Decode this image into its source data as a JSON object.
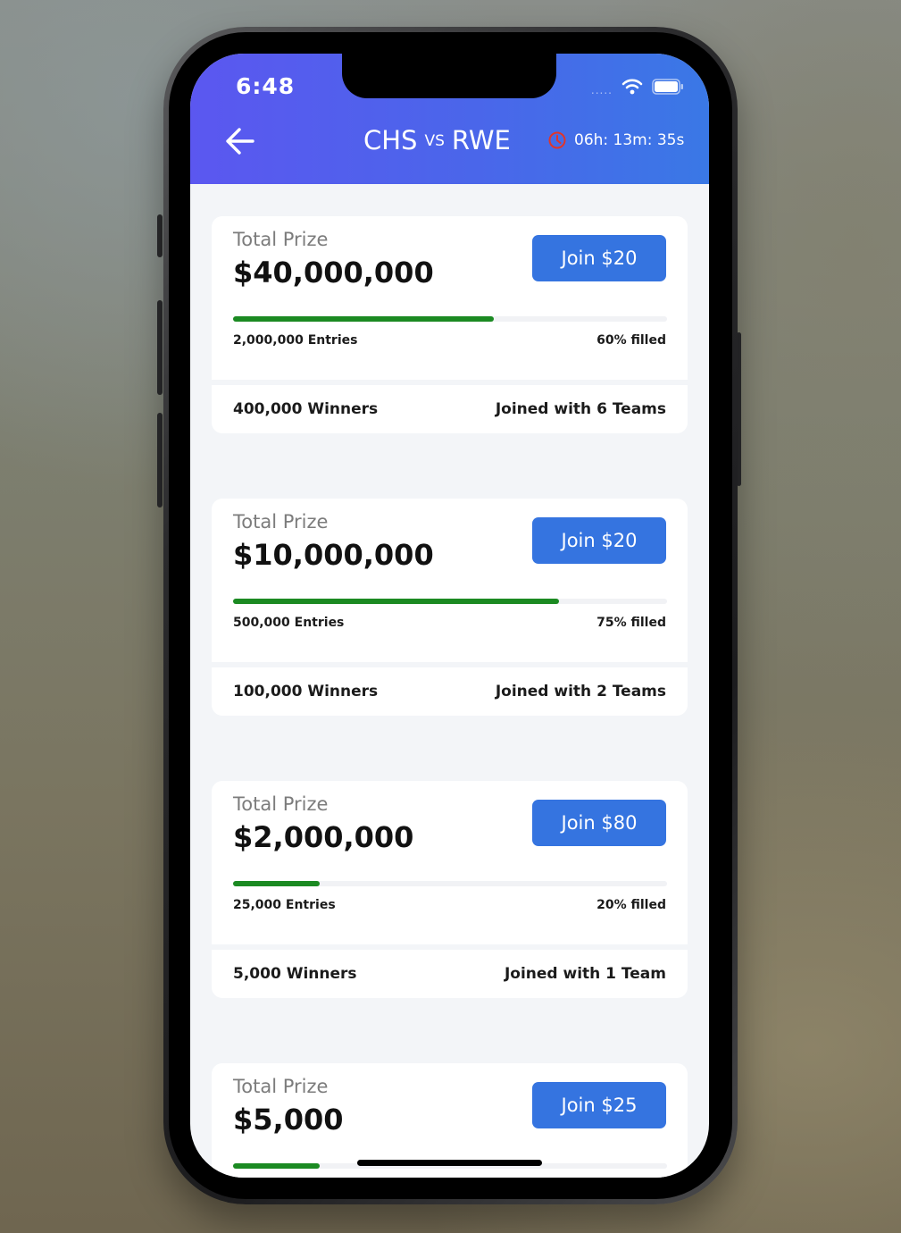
{
  "status_bar": {
    "time": "6:48",
    "signal": "....."
  },
  "header": {
    "team_home": "CHS",
    "vs": "VS",
    "team_away": "RWE",
    "countdown": "06h: 13m: 35s"
  },
  "contests": [
    {
      "prize_label": "Total Prize",
      "prize": "$40,000,000",
      "join_label": "Join $20",
      "entries": "2,000,000 Entries",
      "filled_label": "60% filled",
      "fill_fraction": 0.6,
      "winners": "400,000 Winners",
      "joined": "Joined with 6 Teams"
    },
    {
      "prize_label": "Total Prize",
      "prize": "$10,000,000",
      "join_label": "Join $20",
      "entries": "500,000 Entries",
      "filled_label": "75% filled",
      "fill_fraction": 0.75,
      "winners": "100,000 Winners",
      "joined": "Joined with 2 Teams"
    },
    {
      "prize_label": "Total Prize",
      "prize": "$2,000,000",
      "join_label": "Join $80",
      "entries": "25,000 Entries",
      "filled_label": "20% filled",
      "fill_fraction": 0.2,
      "winners": "5,000 Winners",
      "joined": "Joined with 1 Team"
    },
    {
      "prize_label": "Total Prize",
      "prize": "$5,000",
      "join_label": "Join $25",
      "fill_fraction": 0.2
    }
  ],
  "colors": {
    "header_start": "#5b57f0",
    "header_end": "#3a78e6",
    "join_button": "#3574e0",
    "progress_fill": "#1b8a22",
    "timer_icon": "#e0352b"
  }
}
